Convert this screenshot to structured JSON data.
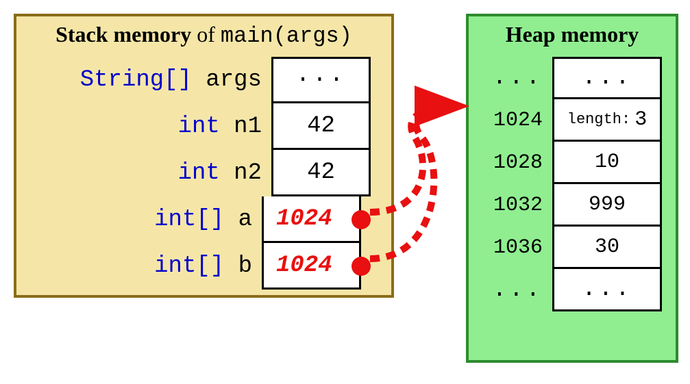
{
  "stack": {
    "title_bold": "Stack memory",
    "title_of": " of ",
    "title_mono": "main(args)",
    "rows": [
      {
        "type": "String[]",
        "name": "args",
        "value": "···",
        "is_pointer": false
      },
      {
        "type": "int",
        "name": "n1",
        "value": "42",
        "is_pointer": false
      },
      {
        "type": "int",
        "name": "n2",
        "value": "42",
        "is_pointer": false
      },
      {
        "type": "int[]",
        "name": "a",
        "value": "1024",
        "is_pointer": true
      },
      {
        "type": "int[]",
        "name": "b",
        "value": "1024",
        "is_pointer": true
      }
    ]
  },
  "heap": {
    "title": "Heap memory",
    "rows": [
      {
        "addr": "...",
        "value": "...",
        "is_length": false,
        "is_dots": true
      },
      {
        "addr": "1024",
        "value": "3",
        "is_length": true,
        "length_label": "length:",
        "is_dots": false
      },
      {
        "addr": "1028",
        "value": "10",
        "is_length": false,
        "is_dots": false
      },
      {
        "addr": "1032",
        "value": "999",
        "is_length": false,
        "is_dots": false
      },
      {
        "addr": "1036",
        "value": "30",
        "is_length": false,
        "is_dots": false
      },
      {
        "addr": "...",
        "value": "...",
        "is_length": false,
        "is_dots": true
      }
    ]
  },
  "colors": {
    "stack_bg": "#f5e6a8",
    "stack_border": "#8a6d1a",
    "heap_bg": "#90ee90",
    "heap_border": "#2e8b2e",
    "type_keyword": "#0000cc",
    "pointer": "#e81010"
  }
}
